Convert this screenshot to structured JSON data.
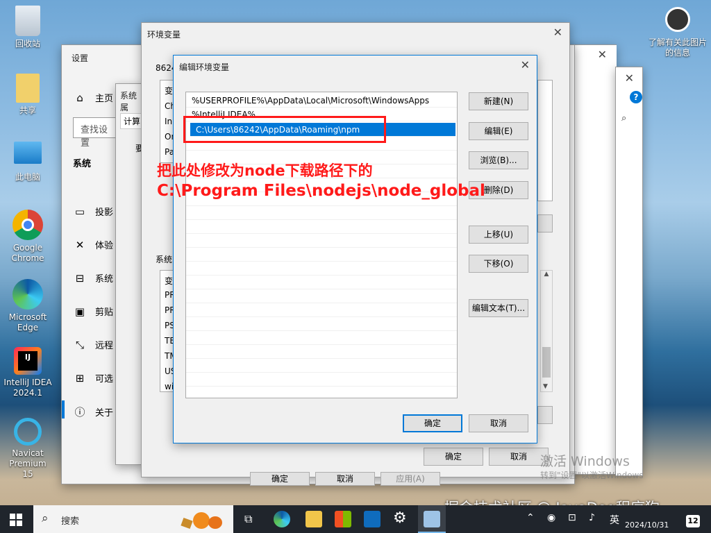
{
  "desktop": {
    "icons": [
      {
        "label": "回收站"
      },
      {
        "label": "共享"
      },
      {
        "label": "此电脑"
      },
      {
        "label": "Google Chrome"
      },
      {
        "label": "Microsoft Edge"
      },
      {
        "label": "IntelliJ IDEA 2024.1"
      },
      {
        "label": "Navicat Premium 15"
      },
      {
        "label": "了解有关此图片的信息"
      }
    ]
  },
  "settings": {
    "title": "设置",
    "search_placeholder": "查找设置",
    "home": "主页",
    "section": "系统",
    "nav": [
      "投影",
      "体验",
      "系统",
      "剪贴",
      "远程",
      "可选",
      "关于"
    ]
  },
  "sysprops": {
    "title": "系统属",
    "tab": "计算",
    "text1": "要"
  },
  "env_window": {
    "title": "环境变量",
    "user_vars_label": "86242",
    "user_rows": [
      "变",
      "Ch",
      "In",
      "On",
      "Pa"
    ],
    "sys_vars_label": "系统",
    "sys_rows": [
      "变",
      "PR",
      "PR",
      "PS",
      "TE",
      "TM",
      "US",
      "wi"
    ],
    "ok": "确定",
    "cancel": "取消"
  },
  "edit_dialog": {
    "title": "编辑环境变量",
    "entries": [
      "%USERPROFILE%\\AppData\\Local\\Microsoft\\WindowsApps",
      "%IntelliJ IDEA%",
      "C:\\Users\\86242\\AppData\\Roaming\\npm"
    ],
    "selected_index": 2,
    "buttons": {
      "new": "新建(N)",
      "edit": "编辑(E)",
      "browse": "浏览(B)...",
      "delete": "删除(D)",
      "up": "上移(U)",
      "down": "下移(O)",
      "edit_text": "编辑文本(T)..."
    },
    "ok": "确定",
    "cancel": "取消"
  },
  "back_dialog": {
    "ok": "确定",
    "cancel": "取消",
    "apply": "应用(A)"
  },
  "annotation": {
    "line1": "把此处修改为node下载路径下的",
    "line2": "C:\\Program Files\\nodejs\\node_global"
  },
  "watermark": {
    "activate": "激活 Windows",
    "activate_sub": "转到\"设置\"以激活Windows",
    "site": "掘金技术社区 @ JavaDog程序狗"
  },
  "taskbar": {
    "search": "搜索",
    "lang": "英",
    "date": "2024/10/31",
    "notif": "12"
  },
  "colors": {
    "accent": "#0078d7",
    "annotation": "#ff1a1a"
  }
}
